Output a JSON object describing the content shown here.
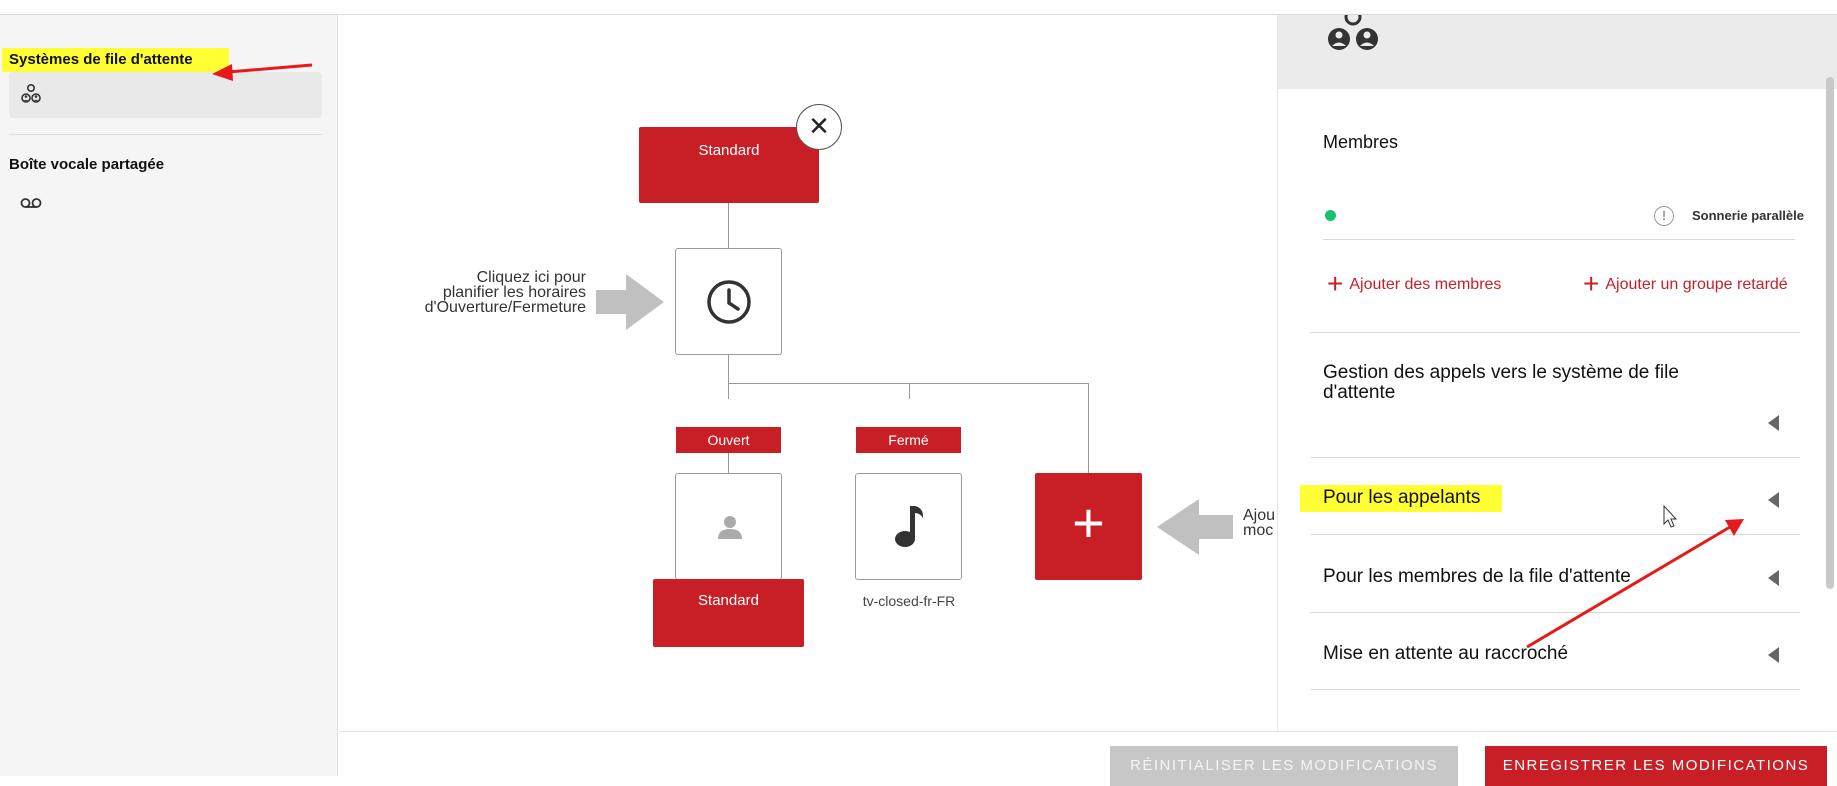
{
  "sidebar": {
    "queue_title": "Systèmes de file d'attente",
    "voicemail_title": "Boîte vocale partagée"
  },
  "canvas": {
    "top_node": "Standard",
    "close_symbol": "✕",
    "hint_schedule": [
      "Cliquez ici pour",
      "planifier les horaires",
      "d'Ouverture/Fermeture"
    ],
    "tag_open": "Ouvert",
    "tag_closed": "Fermé",
    "open_node_label": "Standard",
    "closed_node_caption": "tv-closed-fr-FR",
    "add_symbol": "+",
    "hint_add": [
      "Ajou",
      "moc"
    ]
  },
  "panel": {
    "members_title": "Membres",
    "warn_symbol": "!",
    "ring_mode": "Sonnerie parallèle",
    "add_members": "Ajouter des membres",
    "add_delayed_group": "Ajouter un groupe retardé",
    "plus_symbol": "+",
    "section_call_mgmt": [
      "Gestion des appels vers le système de file",
      "d'attente"
    ],
    "section_callers": "Pour les appelants",
    "section_queue_members": "Pour les membres de la file d'attente",
    "section_hold_hangup": "Mise en attente au raccroché"
  },
  "footer": {
    "reset": "RÉINITIALISER LES MODIFICATIONS",
    "save": "ENREGISTRER LES MODIFICATIONS"
  },
  "colors": {
    "brand_red": "#c81f27",
    "highlight": "#ffff33",
    "status_green": "#16c26c"
  }
}
